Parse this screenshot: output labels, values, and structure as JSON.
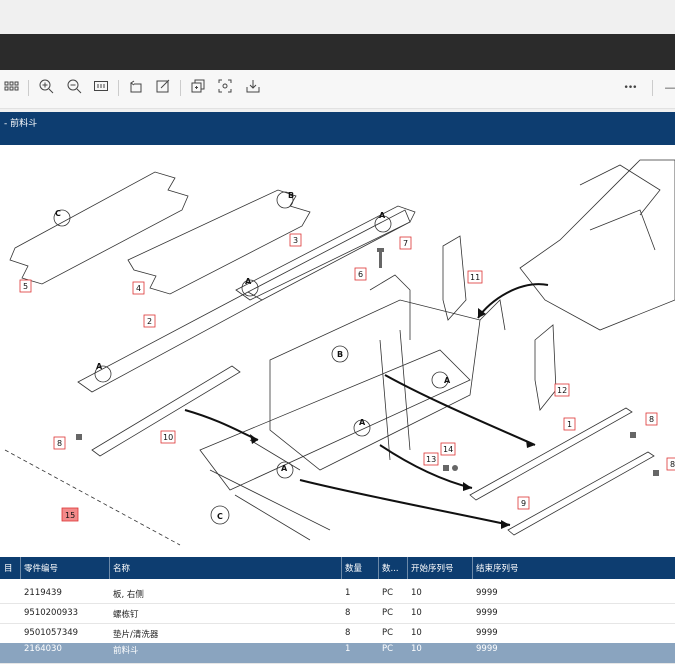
{
  "toolbar": {
    "icons": [
      "grid-icon",
      "zoom-in-icon",
      "zoom-out-icon",
      "fit-icon",
      "rotate-icon",
      "edit-icon",
      "copy-icon",
      "screenshot-icon",
      "download-icon"
    ],
    "more_label": "•••",
    "minimize_label": "—"
  },
  "title": "- 前料斗",
  "callouts": [
    "1",
    "2",
    "3",
    "4",
    "5",
    "6",
    "7",
    "8",
    "8",
    "9",
    "10",
    "11",
    "12",
    "13",
    "14",
    "15"
  ],
  "detail_letters": [
    "A",
    "B",
    "C"
  ],
  "table": {
    "headers": [
      "目",
      "零件编号",
      "名称",
      "数量",
      "数...",
      "开始序列号",
      "结束序列号"
    ],
    "rows": [
      {
        "item": "",
        "part": "2119439",
        "name": "板, 右侧",
        "qty": "1",
        "unit": "PC",
        "start": "10",
        "end": "9999"
      },
      {
        "item": "",
        "part": "9510200933",
        "name": "螺栋钉",
        "qty": "8",
        "unit": "PC",
        "start": "10",
        "end": "9999"
      },
      {
        "item": "",
        "part": "9501057349",
        "name": "垫片/清洗器",
        "qty": "8",
        "unit": "PC",
        "start": "10",
        "end": "9999"
      },
      {
        "item": "",
        "part": "2164030",
        "name": "前料斗",
        "qty": "1",
        "unit": "PC",
        "start": "10",
        "end": "9999"
      }
    ]
  }
}
